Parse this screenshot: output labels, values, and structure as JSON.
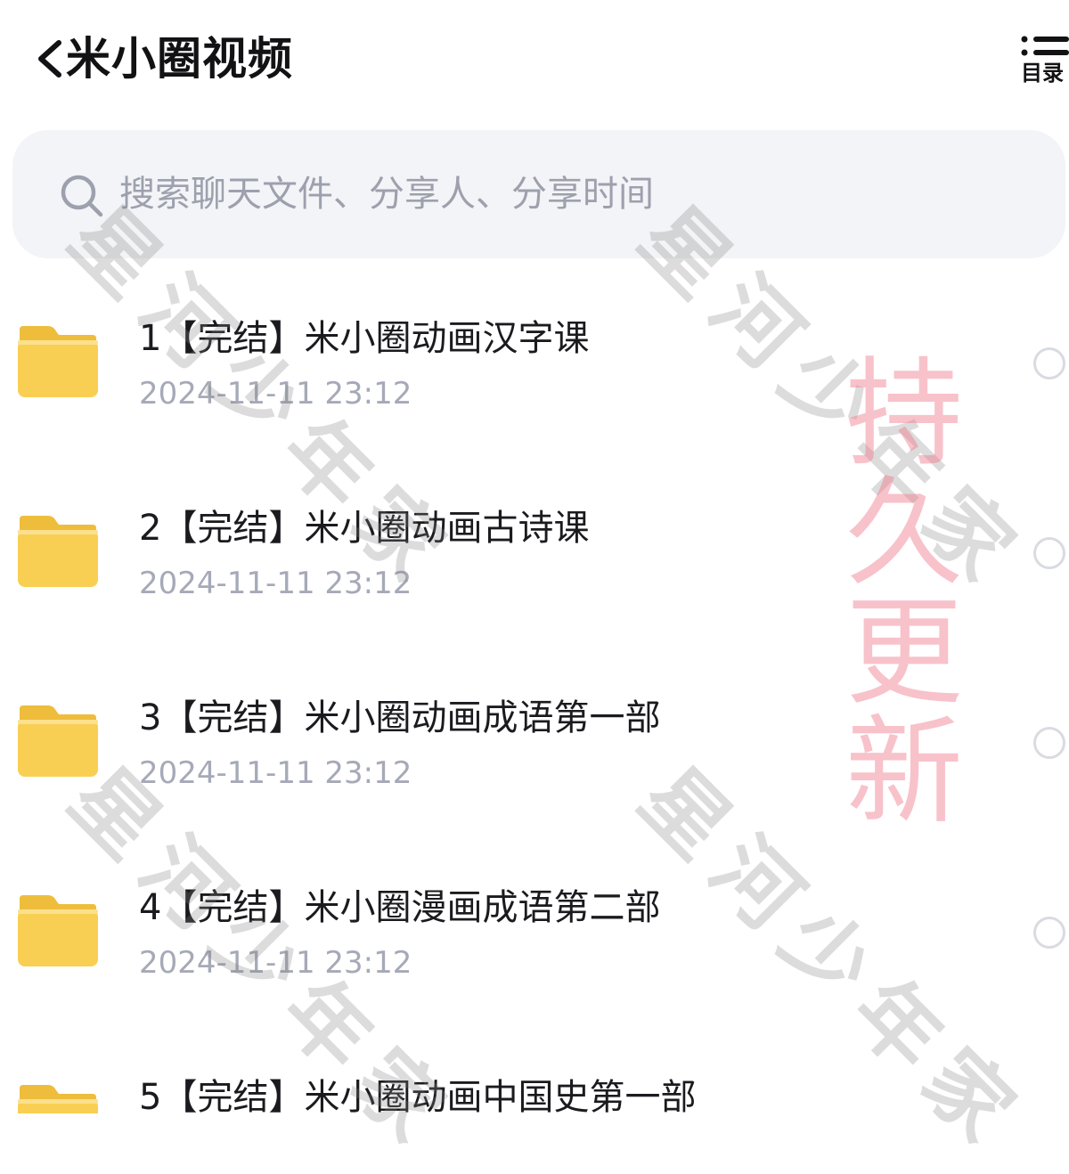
{
  "header": {
    "back_icon": "chevron-left-icon",
    "title": "米小圈视频",
    "catalog_icon": "list-icon",
    "catalog_label": "目录"
  },
  "search": {
    "icon": "search-icon",
    "placeholder": "搜索聊天文件、分享人、分享时间",
    "value": ""
  },
  "files": [
    {
      "name": "1【完结】米小圈动画汉字课",
      "time": "2024-11-11 23:12",
      "icon": "folder-icon"
    },
    {
      "name": "2【完结】米小圈动画古诗课",
      "time": "2024-11-11 23:12",
      "icon": "folder-icon"
    },
    {
      "name": "3【完结】米小圈动画成语第一部",
      "time": "2024-11-11 23:12",
      "icon": "folder-icon"
    },
    {
      "name": "4【完结】米小圈漫画成语第二部",
      "time": "2024-11-11 23:12",
      "icon": "folder-icon"
    },
    {
      "name": "5【完结】米小圈动画中国史第一部",
      "time": "",
      "icon": "folder-icon"
    }
  ],
  "watermark": {
    "text": "星河少年家"
  },
  "promo_stamp": {
    "lines": [
      "持",
      "久",
      "更",
      "新"
    ]
  },
  "colors": {
    "folder": "#f9cf53",
    "folder_dark": "#eebd3c",
    "search_bg": "#f3f4f7",
    "placeholder": "#9da0ad",
    "timestamp": "#a6a9b7",
    "stamp": "#f0788c"
  }
}
